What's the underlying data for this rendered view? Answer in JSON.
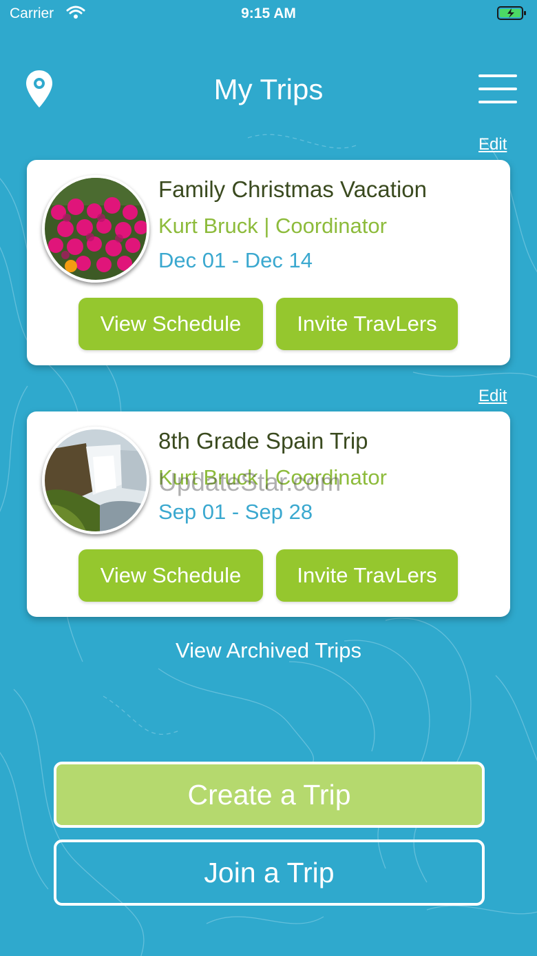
{
  "status_bar": {
    "carrier": "Carrier",
    "time": "9:15 AM"
  },
  "header": {
    "title": "My Trips"
  },
  "trips": [
    {
      "edit_label": "Edit",
      "name": "Family Christmas Vacation",
      "coordinator": "Kurt Bruck | Coordinator",
      "dates": "Dec 01 - Dec 14",
      "view_schedule_label": "View Schedule",
      "invite_label": "Invite TravLers"
    },
    {
      "edit_label": "Edit",
      "name": "8th Grade Spain Trip",
      "coordinator": "Kurt Bruck | Coordinator",
      "dates": "Sep 01 - Sep 28",
      "view_schedule_label": "View Schedule",
      "invite_label": "Invite TravLers",
      "watermark": "UpdateStar.com"
    }
  ],
  "archived_link": "View Archived Trips",
  "actions": {
    "create_label": "Create a Trip",
    "join_label": "Join a Trip"
  },
  "colors": {
    "background": "#2fa9cd",
    "accent_green": "#95c72e",
    "create_green": "#b5d96e"
  }
}
